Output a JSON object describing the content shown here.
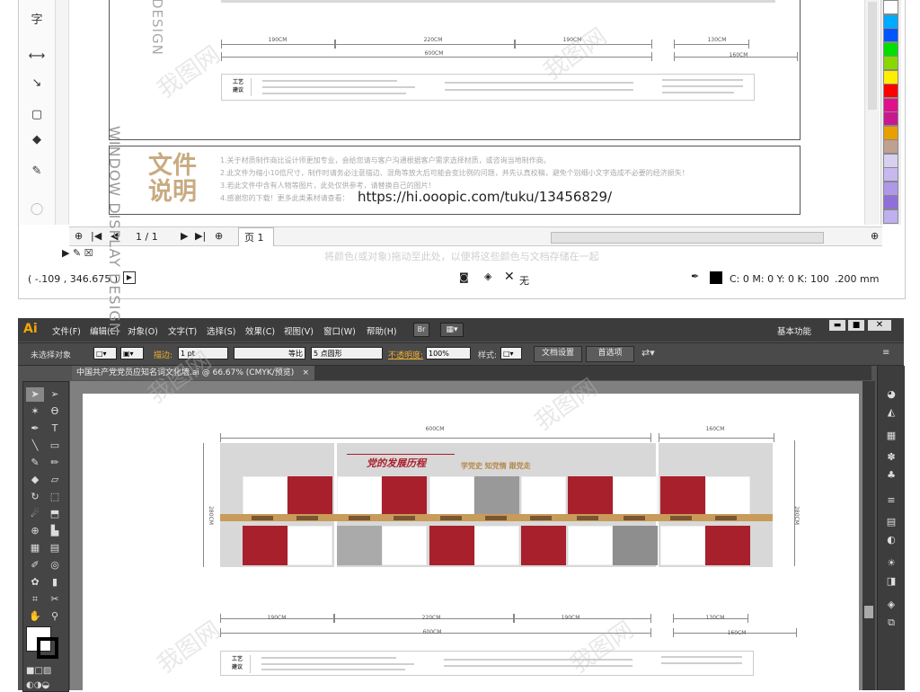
{
  "corel": {
    "tool_glyph_text": "字",
    "dimensions_top": {
      "a": "190CM",
      "b": "220CM",
      "c": "190CM",
      "total": "600CM",
      "d": "130CM",
      "e": "160CM"
    },
    "craft_tag": "工艺\n建议",
    "doc_title": "文件\n说明",
    "notes": [
      "1.关于材质制作商比设计师更加专业，会给您请与客户沟通根据客户需求选择材质，或咨询当地制作商。",
      "2.此文件为缩小10倍尺寸，制作时请务必注意描边、混角等放大后可能会变比例的问题，并先认真校稿，避免个别细小文字造成不必要的经济损失！",
      "3.若此文件中含有人物等图片，此处仅供参考，请替换自己的图片！",
      "4.感谢您的下载！更多此类素材请查看："
    ],
    "url": "https://hi.ooopic.com/tuku/13456829/",
    "page_indicator": "1 / 1",
    "page_tab": "页 1",
    "hint": "将颜色(或对象)拖动至此处，以便将这些颜色与文档存储在一起",
    "coords": "( -.109 , 346.675 )",
    "fill_none": "无",
    "color_readout": "C: 0 M: 0 Y: 0 K: 100",
    "stroke_width": ".200 mm",
    "swatches": [
      "#ffffff",
      "#00aaff",
      "#0055ff",
      "#00e000",
      "#88d800",
      "#ffee00",
      "#ff0000",
      "#e0108c",
      "#c81890",
      "#e8a000",
      "#c0a090",
      "#d8d0f0",
      "#c8b8f0",
      "#b098e8",
      "#9070d8",
      "#c0b0f0"
    ]
  },
  "ai": {
    "logo": "Ai",
    "menus": [
      "文件(F)",
      "编辑(E)",
      "对象(O)",
      "文字(T)",
      "选择(S)",
      "效果(C)",
      "视图(V)",
      "窗口(W)",
      "帮助(H)"
    ],
    "workspace": "基本功能",
    "ctrl": {
      "no_selection": "未选择对象",
      "stroke_label": "描边:",
      "stroke_value": "1 pt",
      "profile": "等比",
      "brush": "5 点圆形",
      "opacity_label": "不透明度:",
      "opacity_value": "100%",
      "style_label": "样式:",
      "doc_setup": "文档设置",
      "prefs": "首选项"
    },
    "tab_title": "中国共产党党员应知名词文化墙.ai @ 66.67% (CMYK/预览)",
    "artboard": {
      "design_text": "WINDOW DISPLAY DESIGN",
      "dim_top_total": "600CM",
      "dim_top_right": "160CM",
      "dim_left": "280CM",
      "dim_right": "280CM",
      "banner_title": "党的发展历程",
      "banner_slogan": "学党史 知党情 跟党走",
      "dimensions_bottom": {
        "a": "190CM",
        "b": "220CM",
        "c": "190CM",
        "total": "600CM",
        "d": "130CM",
        "e": "160CM"
      },
      "craft_tag": "工艺\n建议"
    }
  },
  "watermark": "我图网"
}
